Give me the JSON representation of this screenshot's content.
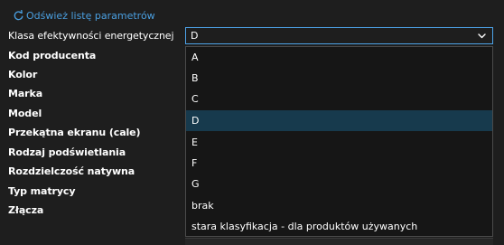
{
  "refresh": {
    "label": "Odśwież listę parametrów",
    "icon": "refresh-icon"
  },
  "params": [
    {
      "label": "Klasa efektywności energetycznej"
    },
    {
      "label": "Kod producenta"
    },
    {
      "label": "Kolor"
    },
    {
      "label": "Marka"
    },
    {
      "label": "Model"
    },
    {
      "label": "Przekątna ekranu (cale)"
    },
    {
      "label": "Rodzaj podświetlania"
    },
    {
      "label": "Rozdzielczość natywna"
    },
    {
      "label": "Typ matrycy"
    },
    {
      "label": "Złącza"
    }
  ],
  "select": {
    "value": "D",
    "icon": "chevron-down-icon",
    "options": [
      {
        "label": "A"
      },
      {
        "label": "B"
      },
      {
        "label": "C"
      },
      {
        "label": "D",
        "selected": true
      },
      {
        "label": "E"
      },
      {
        "label": "F"
      },
      {
        "label": "G"
      },
      {
        "label": "brak"
      },
      {
        "label": "stara klasyfikacja - dla produktów używanych"
      }
    ]
  },
  "colors": {
    "background": "#1e1e1e",
    "link": "#4a9fe0",
    "focus_border": "#4da3e8",
    "selected_option": "#173a4d",
    "text": "#ffffff"
  }
}
